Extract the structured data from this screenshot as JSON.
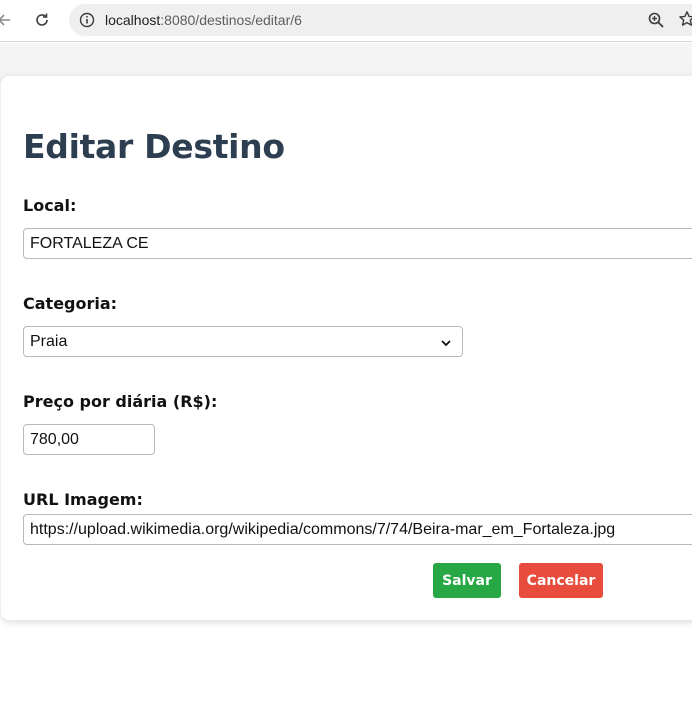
{
  "browser": {
    "url_host": "localhost",
    "url_rest": ":8080/destinos/editar/6",
    "icons": [
      "back-icon",
      "reload-icon",
      "site-info-icon",
      "zoom-icon",
      "bookmark-star-icon"
    ]
  },
  "page": {
    "title": "Editar Destino",
    "fields": {
      "local": {
        "label": "Local:",
        "value": "FORTALEZA CE"
      },
      "categoria": {
        "label": "Categoria:",
        "value": "Praia"
      },
      "preco": {
        "label": "Preço por diária (R$):",
        "value": "780,00"
      },
      "imagem": {
        "label": "URL Imagem:",
        "value": "https://upload.wikimedia.org/wikipedia/commons/7/74/Beira-mar_em_Fortaleza.jpg"
      }
    },
    "buttons": {
      "save": "Salvar",
      "cancel": "Cancelar"
    }
  },
  "colors": {
    "title": "#2c3e50",
    "save": "#28a745",
    "cancel": "#e74c3c"
  }
}
